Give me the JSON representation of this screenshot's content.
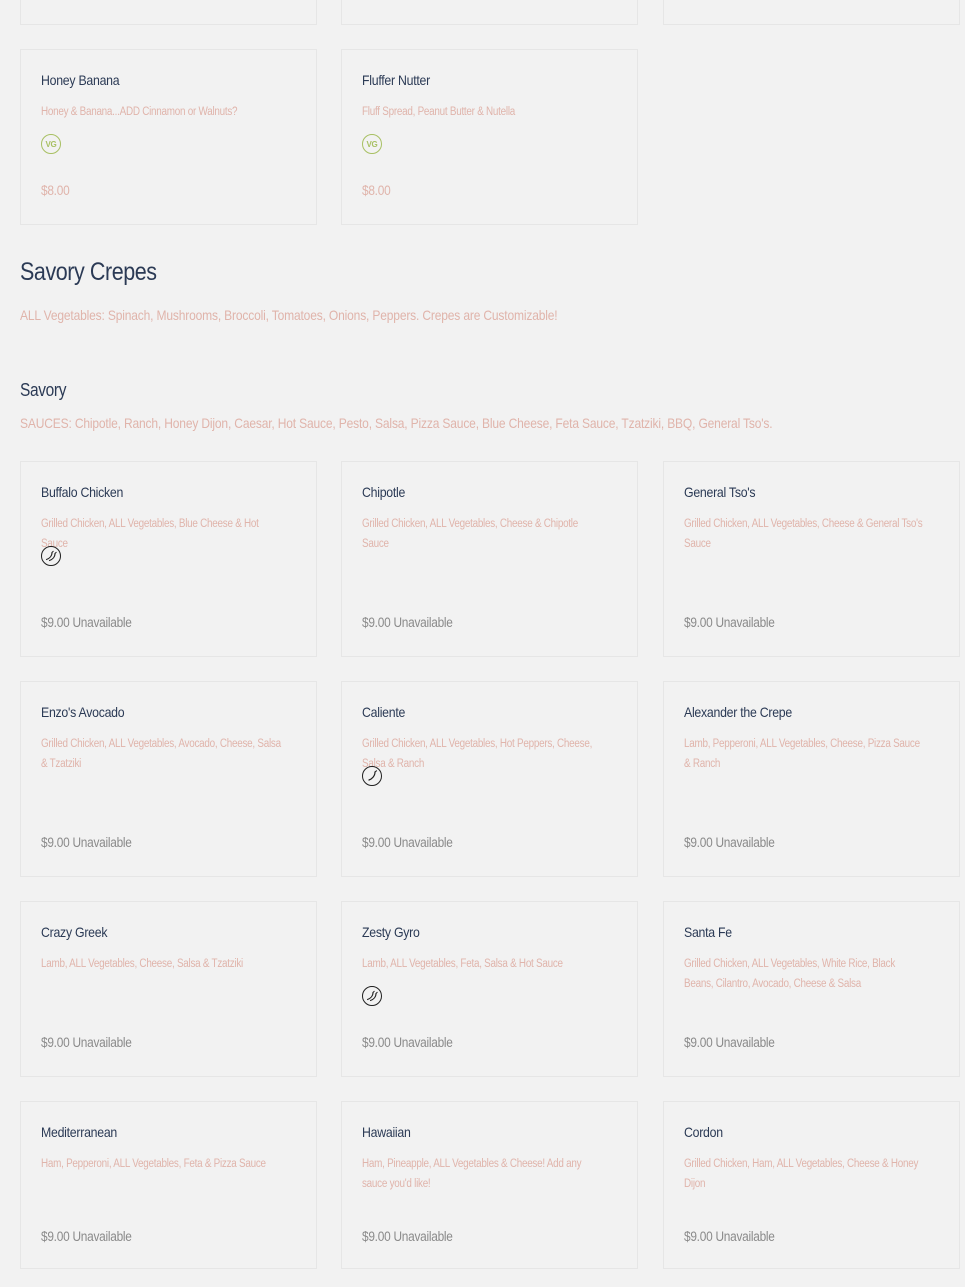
{
  "sweet_items": [
    {
      "name": "Honey Banana",
      "description": "Honey & Banana...ADD Cinnamon or Walnuts?",
      "badge": "VG",
      "price": "$8.00",
      "status": ""
    },
    {
      "name": "Fluffer Nutter",
      "description": "Fluff Spread, Peanut Butter & Nutella",
      "badge": "VG",
      "price": "$8.00",
      "status": ""
    }
  ],
  "section": {
    "title": "Savory Crepes",
    "description": "ALL Vegetables: Spinach, Mushrooms, Broccoli, Tomatoes, Onions, Peppers. Crepes are Customizable!"
  },
  "subsection": {
    "title": "Savory",
    "description": "SAUCES: Chipotle, Ranch, Honey Dijon, Caesar, Hot Sauce, Pesto, Salsa, Pizza Sauce, Blue Cheese, Feta Sauce, Tzatziki, BBQ, General Tso's."
  },
  "savory_items": [
    {
      "name": "Buffalo Chicken",
      "description": "Grilled Chicken, ALL Vegetables, Blue Cheese & Hot Sauce",
      "badge": "spicy-2-icon",
      "price": "$9.00",
      "status": "Unavailable"
    },
    {
      "name": "Chipotle",
      "description": "Grilled Chicken, ALL Vegetables, Cheese & Chipotle Sauce",
      "badge": "",
      "price": "$9.00",
      "status": "Unavailable"
    },
    {
      "name": "General Tso's",
      "description": "Grilled Chicken, ALL Vegetables, Cheese & General Tso's Sauce",
      "badge": "",
      "price": "$9.00",
      "status": "Unavailable"
    },
    {
      "name": "Enzo's Avocado",
      "description": "Grilled Chicken, ALL Vegetables, Avocado, Cheese, Salsa & Tzatziki",
      "badge": "",
      "price": "$9.00",
      "status": "Unavailable"
    },
    {
      "name": "Caliente",
      "description": "Grilled Chicken, ALL Vegetables, Hot Peppers, Cheese, Salsa & Ranch",
      "badge": "spicy-1-icon",
      "price": "$9.00",
      "status": "Unavailable"
    },
    {
      "name": "Alexander the Crepe",
      "description": "Lamb, Pepperoni, ALL Vegetables, Cheese, Pizza Sauce & Ranch",
      "badge": "",
      "price": "$9.00",
      "status": "Unavailable"
    },
    {
      "name": "Crazy Greek",
      "description": "Lamb, ALL Vegetables, Cheese, Salsa & Tzatziki",
      "badge": "",
      "price": "$9.00",
      "status": "Unavailable"
    },
    {
      "name": "Zesty Gyro",
      "description": "Lamb, ALL Vegetables, Feta, Salsa & Hot Sauce",
      "badge": "spicy-2-icon",
      "price": "$9.00",
      "status": "Unavailable"
    },
    {
      "name": "Santa Fe",
      "description": "Grilled Chicken, ALL Vegetables, White Rice, Black Beans, Cilantro, Avocado, Cheese & Salsa",
      "badge": "",
      "price": "$9.00",
      "status": "Unavailable"
    },
    {
      "name": "Mediterranean",
      "description": "Ham, Pepperoni, ALL Vegetables, Feta & Pizza Sauce",
      "badge": "",
      "price": "$9.00",
      "status": "Unavailable"
    },
    {
      "name": "Hawaiian",
      "description": "Ham, Pineapple, ALL Vegetables & Cheese! Add any sauce you'd like!",
      "badge": "",
      "price": "$9.00",
      "status": "Unavailable"
    },
    {
      "name": "Cordon",
      "description": "Grilled Chicken, Ham, ALL Vegetables, Cheese & Honey Dijon",
      "badge": "",
      "price": "$9.00",
      "status": "Unavailable"
    }
  ],
  "colors": {
    "background": "#f2f2f2",
    "heading": "#2b3a55",
    "description": "#e0b4ab",
    "price": "#8a8a8a",
    "vegetarian_badge": "#a8c063"
  }
}
